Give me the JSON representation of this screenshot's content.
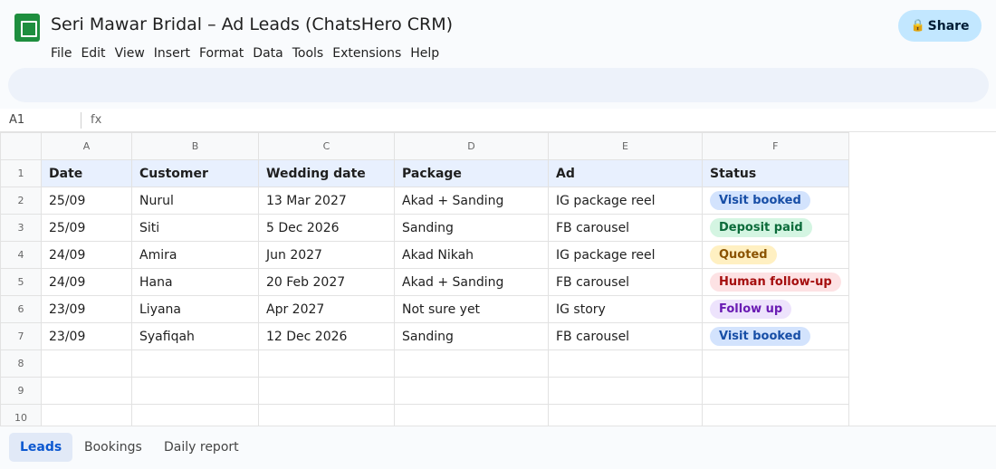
{
  "app": {
    "title": "Seri Mawar Bridal – Ad Leads (ChatsHero CRM)",
    "share_label": "Share"
  },
  "menu": [
    "File",
    "Edit",
    "View",
    "Insert",
    "Format",
    "Data",
    "Tools",
    "Extensions",
    "Help"
  ],
  "formula_bar": {
    "cell_ref": "A1",
    "fx": "fx"
  },
  "columns": [
    "A",
    "B",
    "C",
    "D",
    "E",
    "F"
  ],
  "row_numbers": [
    "1",
    "2",
    "3",
    "4",
    "5",
    "6",
    "7",
    "8",
    "9",
    "10"
  ],
  "table": {
    "headers": [
      "Date",
      "Customer",
      "Wedding date",
      "Package",
      "Ad",
      "Status"
    ],
    "rows": [
      {
        "date": "25/09",
        "customer": "Nurul",
        "wedding": "13 Mar 2027",
        "package": "Akad + Sanding",
        "ad": "IG package reel",
        "status": "Visit booked",
        "status_bg": "#d3e3fd",
        "status_fg": "#174ea6"
      },
      {
        "date": "25/09",
        "customer": "Siti",
        "wedding": "5 Dec 2026",
        "package": "Sanding",
        "ad": "FB carousel",
        "status": "Deposit paid",
        "status_bg": "#d4f5e2",
        "status_fg": "#0b6b3a"
      },
      {
        "date": "24/09",
        "customer": "Amira",
        "wedding": "Jun 2027",
        "package": "Akad Nikah",
        "ad": "IG package reel",
        "status": "Quoted",
        "status_bg": "#fff0c2",
        "status_fg": "#8a5300"
      },
      {
        "date": "24/09",
        "customer": "Hana",
        "wedding": "20 Feb 2027",
        "package": "Akad + Sanding",
        "ad": "FB carousel",
        "status": "Human follow-up",
        "status_bg": "#fde2e4",
        "status_fg": "#a50e0e"
      },
      {
        "date": "23/09",
        "customer": "Liyana",
        "wedding": "Apr 2027",
        "package": "Not sure yet",
        "ad": "IG story",
        "status": "Follow up",
        "status_bg": "#ede3fc",
        "status_fg": "#6a1bb3"
      },
      {
        "date": "23/09",
        "customer": "Syafiqah",
        "wedding": "12 Dec 2026",
        "package": "Sanding",
        "ad": "FB carousel",
        "status": "Visit booked",
        "status_bg": "#d3e3fd",
        "status_fg": "#174ea6"
      }
    ]
  },
  "tabs": [
    "Leads",
    "Bookings",
    "Daily report"
  ],
  "colors": {
    "accent": "#0b57d0",
    "header_row_bg": "#e8f0fe",
    "logo": "#1e8e3e",
    "share_bg": "#c2e7ff"
  }
}
